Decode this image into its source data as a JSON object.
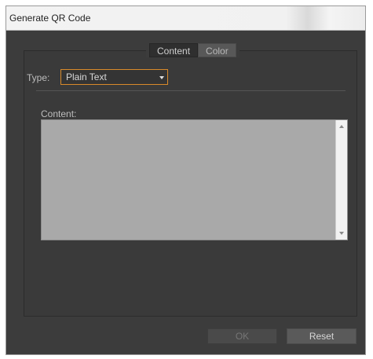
{
  "window": {
    "title": "Generate QR Code"
  },
  "tabs": [
    {
      "label": "Content",
      "active": true
    },
    {
      "label": "Color",
      "active": false
    }
  ],
  "type_field": {
    "label": "Type:",
    "selected": "Plain Text"
  },
  "content_field": {
    "label": "Content:",
    "value": ""
  },
  "buttons": {
    "ok_label": "OK",
    "ok_enabled": false,
    "reset_label": "Reset"
  },
  "colors": {
    "dialog_background": "#3c3c3c",
    "focus_accent": "#d98a2a",
    "textarea_background": "#a9a9a9"
  }
}
